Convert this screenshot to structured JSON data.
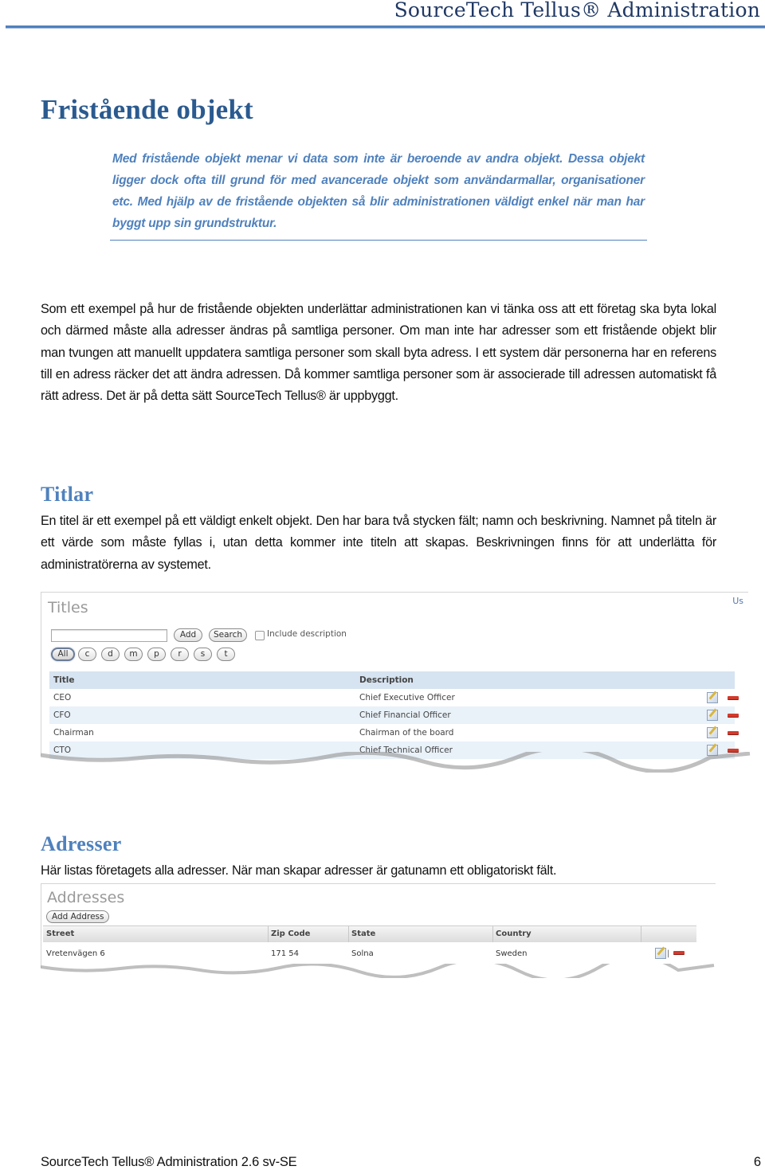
{
  "header": {
    "title": "SourceTech Tellus® Administration"
  },
  "section": {
    "title": "Fristående objekt",
    "intro": "Med fristående objekt menar vi data som inte är beroende av andra objekt. Dessa objekt ligger dock ofta till grund för med avancerade objekt som användarmallar, organisationer etc. Med hjälp av de fristående objekten så blir administrationen väldigt enkel när man har byggt upp sin grundstruktur.",
    "body": "Som ett exempel på hur de fristående objekten underlättar administrationen kan vi tänka oss att ett företag ska byta lokal och därmed måste alla adresser ändras på samtliga personer. Om man inte har adresser som ett fristående objekt blir man tvungen att manuellt uppdatera samtliga personer som skall byta adress. I ett system där personerna har en referens till en adress räcker det att ändra adressen. Då kommer samtliga personer som är associerade till adressen automatiskt få rätt adress. Det är på detta sätt SourceTech Tellus® är uppbyggt."
  },
  "titlar": {
    "heading": "Titlar",
    "body": "En titel är ett exempel på ett väldigt enkelt objekt. Den har bara två stycken fält; namn och beskrivning. Namnet på titeln är ett värde som måste fyllas i, utan detta kommer inte titeln att skapas. Beskrivningen finns för att underlätta för administratörerna av systemet.",
    "screenshot": {
      "panel_title": "Titles",
      "user_link": "Us",
      "search_value": "",
      "add_label": "Add",
      "search_label": "Search",
      "include_description_label": "Include description",
      "include_description_checked": false,
      "filters": [
        "All",
        "c",
        "d",
        "m",
        "p",
        "r",
        "s",
        "t"
      ],
      "active_filter": "All",
      "columns": [
        "Title",
        "Description"
      ],
      "rows": [
        {
          "title": "CEO",
          "description": "Chief Executive Officer"
        },
        {
          "title": "CFO",
          "description": "Chief Financial Officer"
        },
        {
          "title": "Chairman",
          "description": "Chairman of the board"
        },
        {
          "title": "CTO",
          "description": "Chief Technical Officer"
        }
      ],
      "row_actions": {
        "edit_icon": "edit-icon",
        "delete_icon": "delete-icon"
      }
    }
  },
  "adresser": {
    "heading": "Adresser",
    "body": "Här listas företagets alla adresser. När man skapar adresser är gatunamn ett obligatoriskt fält.",
    "screenshot": {
      "panel_title": "Addresses",
      "add_label": "Add Address",
      "columns": [
        "Street",
        "Zip Code",
        "State",
        "Country"
      ],
      "rows": [
        {
          "street": "Vretenvägen 6",
          "zip": "171 54",
          "state": "Solna",
          "country": "Sweden"
        }
      ],
      "action_separator": "|"
    }
  },
  "footer": {
    "text": "SourceTech Tellus® Administration 2.6 sv-SE",
    "page_number": "6"
  },
  "colors": {
    "heading": "#2a5a8f",
    "accent": "#4f81bd",
    "table_header": "#d6e3f0",
    "table_alt_row": "#e9f1f9",
    "delete": "#d23a2c"
  }
}
